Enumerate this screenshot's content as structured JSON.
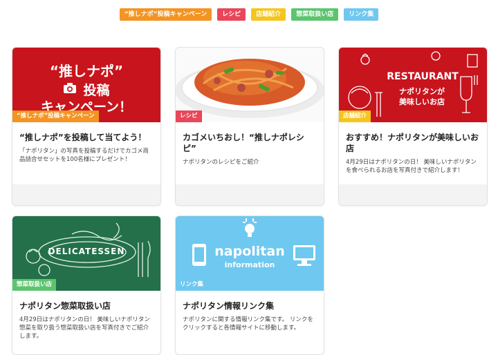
{
  "tags": [
    {
      "label": "“推しナポ”投稿キャンペーン",
      "color": "#f39423"
    },
    {
      "label": "レシピ",
      "color": "#e9465a"
    },
    {
      "label": "店舗紹介",
      "color": "#f5c51c"
    },
    {
      "label": "惣菜取扱い店",
      "color": "#5cc46e"
    },
    {
      "label": "リンク集",
      "color": "#6fc8ef"
    }
  ],
  "cards": [
    {
      "label": "“推しナポ”投稿キャンペーン",
      "title": "“推しナポ”を投稿して当てよう！",
      "desc": "「ナポリタン」の写真を投稿するだけでカゴメ商品詰合せセットを100名様にプレゼント！",
      "image_text": {
        "line1": "“推しナポ”",
        "line2": "投稿",
        "line3": "キャンペーン！"
      }
    },
    {
      "label": "レシピ",
      "title": "カゴメいちおし！“推しナポレシピ”",
      "desc": "ナポリタンのレシピをご紹介"
    },
    {
      "label": "店舗紹介",
      "title": "おすすめ！ナポリタンが美味しいお店",
      "desc": "4月29日はナポリタンの日！ 美味しいナポリタンを食べられるお店を写真付きで紹介します！",
      "image_text": {
        "line1": "RESTAURANT",
        "line2": "ナポリタンが",
        "line3": "美味しいお店"
      }
    },
    {
      "label": "惣菜取扱い店",
      "title": "ナポリタン惣菜取扱い店",
      "desc": "4月29日はナポリタンの日！ 美味しいナポリタン惣菜を取り扱う惣菜取扱い店を写真付きでご紹介します。",
      "image_text": {
        "line1": "DELICATESSEN"
      }
    },
    {
      "label": "リンク集",
      "title": "ナポリタン情報リンク集",
      "desc": "ナポリタンに関する情報リンク集です。 リンクをクリックすると各情報サイトに移動します。",
      "image_text": {
        "line1": "napolitan",
        "line2": "information"
      }
    }
  ]
}
